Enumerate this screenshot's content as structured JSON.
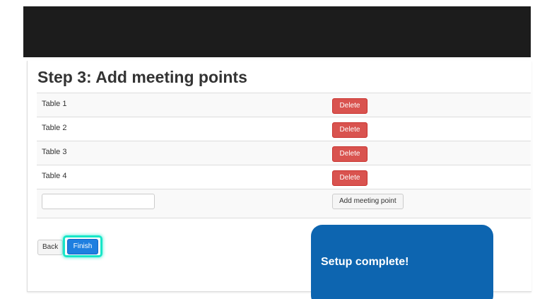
{
  "page": {
    "title": "Step 3: Add meeting points"
  },
  "meeting_points": [
    {
      "label": "Table 1",
      "delete_label": "Delete"
    },
    {
      "label": "Table 2",
      "delete_label": "Delete"
    },
    {
      "label": "Table 3",
      "delete_label": "Delete"
    },
    {
      "label": "Table 4",
      "delete_label": "Delete"
    }
  ],
  "new_point": {
    "value": "",
    "add_label": "Add meeting point"
  },
  "footer": {
    "back_label": "Back",
    "finish_label": "Finish"
  },
  "toast": {
    "message": "Setup complete!"
  },
  "colors": {
    "header_bar": "#1c1c1c",
    "delete_button": "#d9534f",
    "finish_button": "#1e7fe0",
    "highlight_ring": "#17e6c8",
    "toast_background": "#0d65b0"
  }
}
